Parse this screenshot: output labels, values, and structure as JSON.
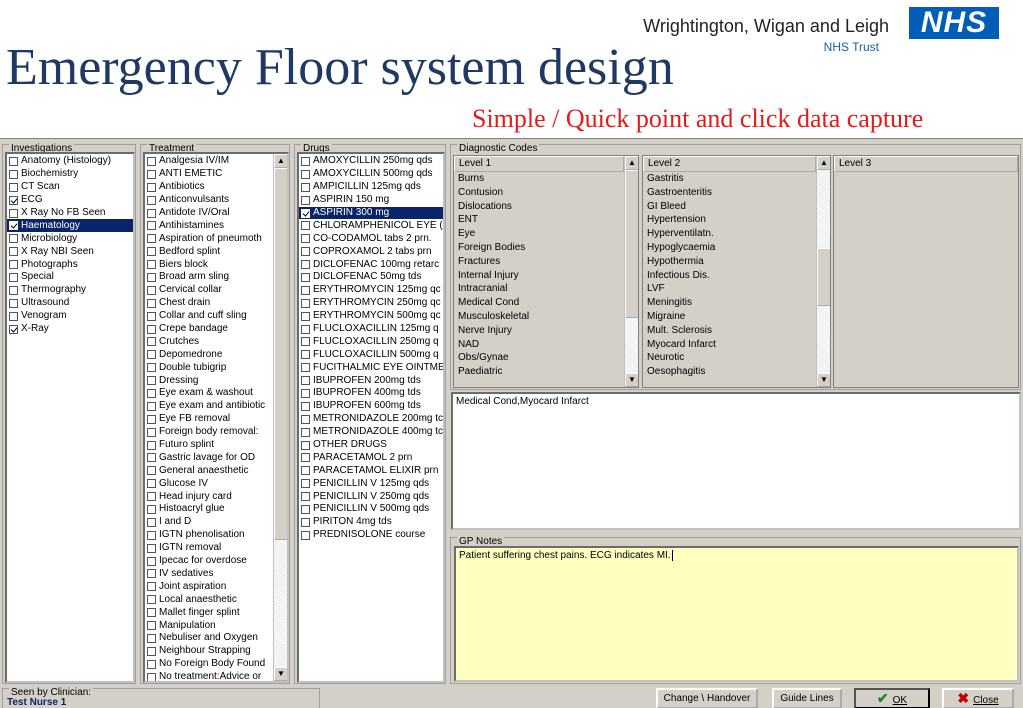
{
  "header": {
    "trust_name": "Wrightington, Wigan and Leigh",
    "trust_sub": "NHS Trust",
    "nhs_logo": "NHS",
    "title": "Emergency Floor system design",
    "subtitle": "Simple / Quick point and click data capture"
  },
  "investigations": {
    "label": "Investigations",
    "items": [
      {
        "label": "Anatomy (Histology)",
        "checked": false
      },
      {
        "label": "Biochemistry",
        "checked": false
      },
      {
        "label": "CT Scan",
        "checked": false
      },
      {
        "label": "ECG",
        "checked": true
      },
      {
        "label": "X Ray No FB Seen",
        "checked": false
      },
      {
        "label": "Haematology",
        "checked": true,
        "selected": true
      },
      {
        "label": "Microbiology",
        "checked": false
      },
      {
        "label": "X Ray NBI Seen",
        "checked": false
      },
      {
        "label": "Photographs",
        "checked": false
      },
      {
        "label": "Special",
        "checked": false
      },
      {
        "label": "Thermography",
        "checked": false
      },
      {
        "label": "Ultrasound",
        "checked": false
      },
      {
        "label": "Venogram",
        "checked": false
      },
      {
        "label": "X-Ray",
        "checked": true
      }
    ]
  },
  "treatment": {
    "label": "Treatment",
    "items": [
      "Analgesia IV/IM",
      "ANTI EMETIC",
      "Antibiotics",
      "Anticonvulsants",
      "Antidote IV/Oral",
      "Antihistamines",
      "Aspiration of pneumoth",
      "Bedford splint",
      "Biers block",
      "Broad arm sling",
      "Cervical collar",
      "Chest drain",
      "Collar and cuff sling",
      "Crepe bandage",
      "Crutches",
      "Depomedrone",
      "Double tubigrip",
      "Dressing",
      "Eye exam & washout",
      "Eye exam and antibiotic",
      "Eye FB removal",
      "Foreign body removal:",
      "Futuro splint",
      "Gastric lavage for OD",
      "General anaesthetic",
      "Glucose IV",
      "Head injury card",
      "Histoacryl glue",
      "I and D",
      "IGTN phenolisation",
      "IGTN removal",
      "Ipecac for overdose",
      "IV sedatives",
      "Joint aspiration",
      "Local anaesthetic",
      "Mallet finger splint",
      "Manipulation",
      "Nebuliser and Oxygen",
      "Neighbour Strapping",
      "No Foreign Body Found",
      "No treatment:Advice or"
    ]
  },
  "drugs": {
    "label": "Drugs",
    "items": [
      {
        "label": "AMOXYCILLIN 250mg qds",
        "checked": false
      },
      {
        "label": "AMOXYCILLIN 500mg qds",
        "checked": false
      },
      {
        "label": "AMPICILLIN 125mg qds",
        "checked": false
      },
      {
        "label": "ASPIRIN 150 mg",
        "checked": false
      },
      {
        "label": "ASPIRIN 300 mg",
        "checked": true,
        "selected": true
      },
      {
        "label": "CHLORAMPHENICOL EYE (",
        "checked": false
      },
      {
        "label": "CO-CODAMOL tabs 2 prn.",
        "checked": false
      },
      {
        "label": "COPROXAMOL 2 tabs prn",
        "checked": false
      },
      {
        "label": "DICLOFENAC 100mg retarc",
        "checked": false
      },
      {
        "label": "DICLOFENAC 50mg tds",
        "checked": false
      },
      {
        "label": "ERYTHROMYCIN 125mg qc",
        "checked": false
      },
      {
        "label": "ERYTHROMYCIN 250mg qc",
        "checked": false
      },
      {
        "label": "ERYTHROMYCIN 500mg qc",
        "checked": false
      },
      {
        "label": "FLUCLOXACILLIN 125mg q",
        "checked": false
      },
      {
        "label": "FLUCLOXACILLIN 250mg q",
        "checked": false
      },
      {
        "label": "FLUCLOXACILLIN 500mg q",
        "checked": false
      },
      {
        "label": "FUCITHALMIC EYE OINTME",
        "checked": false
      },
      {
        "label": "IBUPROFEN 200mg tds",
        "checked": false
      },
      {
        "label": "IBUPROFEN 400mg tds",
        "checked": false
      },
      {
        "label": "IBUPROFEN 600mg tds",
        "checked": false
      },
      {
        "label": "METRONIDAZOLE 200mg tc",
        "checked": false
      },
      {
        "label": "METRONIDAZOLE 400mg tc",
        "checked": false
      },
      {
        "label": "OTHER DRUGS",
        "checked": false
      },
      {
        "label": "PARACETAMOL 2 prn",
        "checked": false
      },
      {
        "label": "PARACETAMOL ELIXIR prn",
        "checked": false
      },
      {
        "label": "PENICILLIN V 125mg qds",
        "checked": false
      },
      {
        "label": "PENICILLIN V 250mg qds",
        "checked": false
      },
      {
        "label": "PENICILLIN V 500mg qds",
        "checked": false
      },
      {
        "label": "PIRITON 4mg tds",
        "checked": false
      },
      {
        "label": "PREDNISOLONE course",
        "checked": false
      }
    ]
  },
  "diagnostic": {
    "label": "Diagnostic Codes",
    "level1": {
      "header": "Level 1",
      "items": [
        "Burns",
        "Contusion",
        "Dislocations",
        "ENT",
        "Eye",
        "Foreign Bodies",
        "Fractures",
        "Internal Injury",
        "Intracranial",
        "Medical Cond",
        "Musculoskeletal",
        "Nerve Injury",
        "NAD",
        "Obs/Gynae",
        "Paediatric"
      ]
    },
    "level2": {
      "header": "Level 2",
      "items": [
        "Gastritis",
        "Gastroenteritis",
        "GI Bleed",
        "Hypertension",
        "Hyperventilatn.",
        "Hypoglycaemia",
        "Hypothermia",
        "Infectious Dis.",
        "LVF",
        "Meningitis",
        "Migraine",
        "Mult. Sclerosis",
        "Myocard Infarct",
        "Neurotic",
        "Oesophagitis"
      ]
    },
    "level3": {
      "header": "Level 3"
    },
    "selected_text": "Medical Cond,Myocard Infarct"
  },
  "gp_notes": {
    "label": "GP Notes",
    "text": "Patient suffering chest pains. ECG indicates MI."
  },
  "footer": {
    "seen_label": "Seen by Clinician:",
    "seen_value": "Test Nurse 1",
    "change_button": "Change \\ Handover",
    "guide_button": "Guide Lines",
    "ok_button": "OK",
    "close_button": "Close"
  }
}
